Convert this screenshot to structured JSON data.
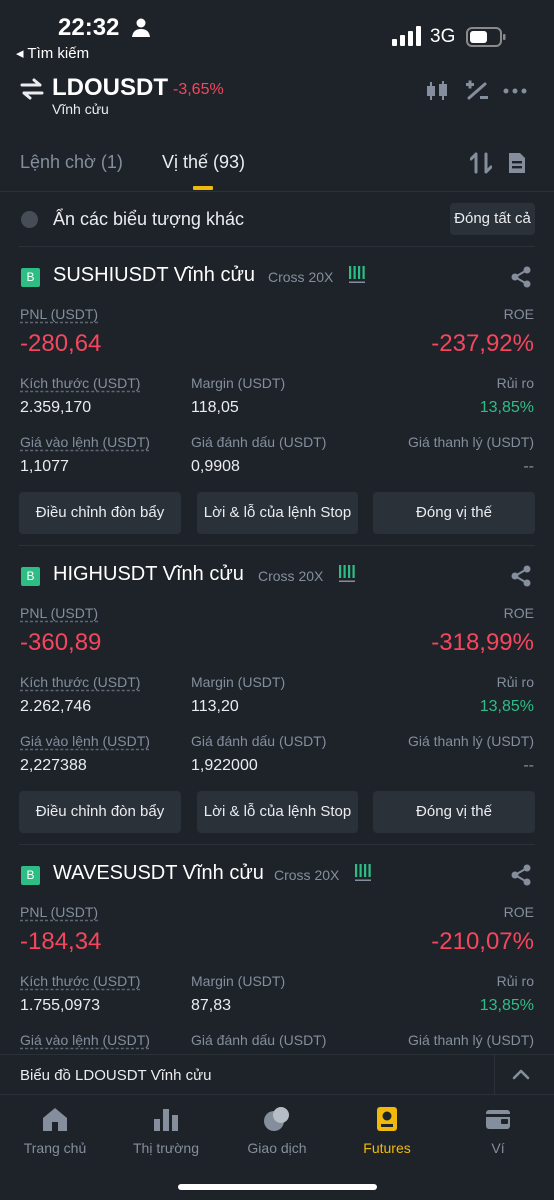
{
  "status_bar": {
    "time": "22:32",
    "back_label": "◂ Tìm kiếm",
    "network": "3G"
  },
  "header": {
    "symbol": "LDOUSDT",
    "change": "-3,65%",
    "subtitle": "Vĩnh cửu",
    "icons": [
      "candlestick-icon",
      "percent-adjust-icon",
      "more-icon"
    ]
  },
  "tabs": {
    "open_orders": "Lệnh chờ (1)",
    "positions": "Vị thế (93)"
  },
  "hide_row": {
    "label": "Ẩn các biểu tượng khác",
    "close_all": "Đóng tất cả"
  },
  "labels": {
    "pnl": "PNL (USDT)",
    "roe": "ROE",
    "size": "Kích thước (USDT)",
    "margin": "Margin (USDT)",
    "risk": "Rủi ro",
    "entry_price": "Giá vào lệnh (USDT)",
    "mark_price": "Giá đánh dấu (USDT)",
    "liq_price": "Giá thanh lý (USDT)",
    "btn_leverage": "Điều chỉnh đòn bẩy",
    "btn_tpsl": "Lời & lỗ của lệnh Stop",
    "btn_close": "Đóng vị thế"
  },
  "positions": [
    {
      "side_badge": "B",
      "symbol": "SUSHIUSDT Vĩnh cửu",
      "margin_mode": "Cross 20X",
      "pnl": "-280,64",
      "roe": "-237,92%",
      "size": "2.359,170",
      "margin": "118,05",
      "risk": "13,85%",
      "entry_price": "1,1077",
      "mark_price": "0,9908",
      "liq_price": "--"
    },
    {
      "side_badge": "B",
      "symbol": "HIGHUSDT Vĩnh cửu",
      "margin_mode": "Cross 20X",
      "pnl": "-360,89",
      "roe": "-318,99%",
      "size": "2.262,746",
      "margin": "113,20",
      "risk": "13,85%",
      "entry_price": "2,227388",
      "mark_price": "1,922000",
      "liq_price": "--"
    },
    {
      "side_badge": "B",
      "symbol": "WAVESUSDT Vĩnh cửu",
      "margin_mode": "Cross 20X",
      "pnl": "-184,34",
      "roe": "-210,07%",
      "size": "1.755,0973",
      "margin": "87,83",
      "risk": "13,85%",
      "entry_price": "",
      "mark_price": "",
      "liq_price": ""
    }
  ],
  "chart_bar": {
    "label": "Biểu đồ LDOUSDT Vĩnh cửu"
  },
  "bottom_nav": [
    {
      "label": "Trang chủ",
      "icon": "home-icon"
    },
    {
      "label": "Thị trường",
      "icon": "market-icon"
    },
    {
      "label": "Giao dịch",
      "icon": "trade-icon"
    },
    {
      "label": "Futures",
      "icon": "futures-icon",
      "active": true
    },
    {
      "label": "Ví",
      "icon": "wallet-icon"
    }
  ],
  "colors": {
    "background": "#1e2329",
    "accent": "#f0b90b",
    "negative": "#f6465d",
    "positive": "#2ebd85"
  }
}
